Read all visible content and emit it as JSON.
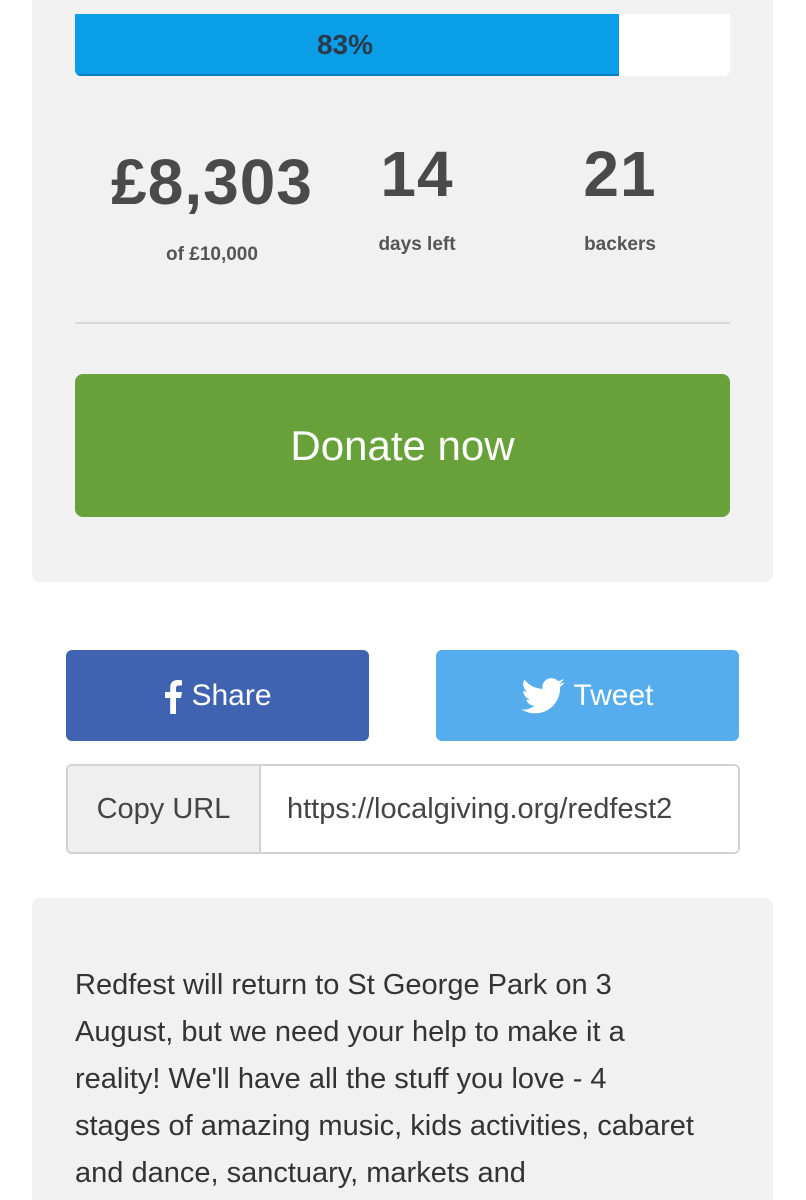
{
  "progress": {
    "percent_label": "83%",
    "fraction": 0.83
  },
  "stats": {
    "raised": "£8,303",
    "target": "of £10,000",
    "days_value": "14",
    "days_label": "days left",
    "backers_value": "21",
    "backers_label": "backers"
  },
  "donate": {
    "label": "Donate now",
    "color": "#68a13a"
  },
  "share": {
    "facebook_label": "Share",
    "facebook_icon": "facebook-icon",
    "facebook_color": "#3f63b0",
    "twitter_label": "Tweet",
    "twitter_icon": "twitter-bird-icon",
    "twitter_color": "#55adee"
  },
  "copy_url": {
    "button_label": "Copy URL",
    "value": "https://localgiving.org/redfest2"
  },
  "description": {
    "text": "Redfest will return to St George Park on 3 August, but we need your help to make it a reality! We'll have all the stuff you love - 4 stages of amazing music, kids activities, cabaret and dance, sanctuary, markets and"
  },
  "colors": {
    "progress_fill": "#0b9ee8",
    "card_background": "#f1f1f1"
  }
}
